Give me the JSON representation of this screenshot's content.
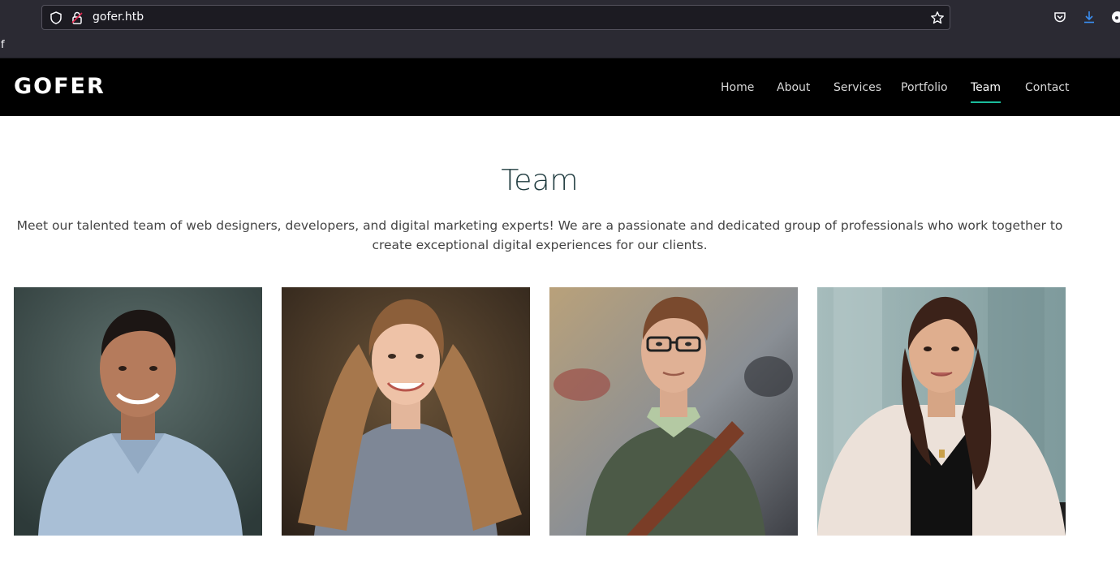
{
  "browser": {
    "url": "gofer.htb",
    "bookmark_label": "f",
    "icons": [
      "shield-icon",
      "lock-warning-icon",
      "star-icon",
      "pocket-icon",
      "download-icon"
    ]
  },
  "header": {
    "logo": "GOFER",
    "nav": [
      {
        "label": "Home"
      },
      {
        "label": "About"
      },
      {
        "label": "Services"
      },
      {
        "label": "Portfolio"
      },
      {
        "label": "Team",
        "active": true
      },
      {
        "label": "Contact"
      }
    ],
    "accent_color": "#1bbd9c"
  },
  "team": {
    "title": "Team",
    "description": "Meet our talented team of web designers, developers, and digital marketing experts! We are a passionate and dedicated group of professionals who work together to create exceptional digital experiences for our clients.",
    "members": [
      {
        "photo": "team-member-photo-1"
      },
      {
        "photo": "team-member-photo-2"
      },
      {
        "photo": "team-member-photo-3"
      },
      {
        "photo": "team-member-photo-4"
      }
    ]
  }
}
